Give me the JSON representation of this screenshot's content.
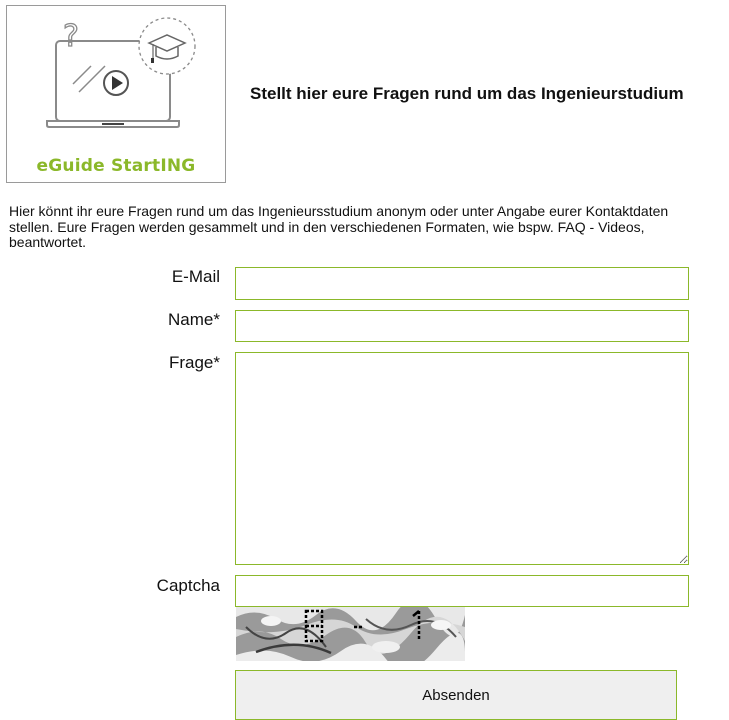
{
  "logo": {
    "brand_text": "eGuide StartING",
    "question_mark": "?",
    "accent_color": "#8bb82a"
  },
  "heading": "Stellt hier eure Fragen rund um das Ingenieurstudium",
  "intro_text": "Hier könnt ihr eure Fragen rund um das Ingenieursstudium anonym oder unter Angabe eurer Kontaktdaten stellen. Eure Fragen werden gesammelt und in den verschiedenen Formaten, wie bspw. FAQ - Videos, beantwortet.",
  "form": {
    "email_label": "E-Mail",
    "email_value": "",
    "name_label": "Name*",
    "name_value": "",
    "question_label": "Frage*",
    "question_value": "",
    "captcha_label": "Captcha",
    "captcha_value": "",
    "captcha_chars": "8 -  1",
    "submit_label": "Absenden"
  },
  "colors": {
    "field_border": "#8bb82a",
    "button_bg": "#efefef"
  }
}
